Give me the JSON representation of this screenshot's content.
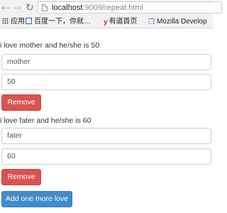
{
  "browser": {
    "url_host": "localhost",
    "url_rest": ":9009/repeat.html",
    "bookmarks": [
      {
        "icon": "apps-icon",
        "label": "应用"
      },
      {
        "icon": "image-icon",
        "label": "百度一下，你就…"
      },
      {
        "icon": "youdao-icon",
        "label": "有道首页"
      },
      {
        "icon": "mozilla-icon",
        "label": "Mozilla Develop"
      }
    ]
  },
  "people": [
    {
      "sentence": "i love mother and he/she is 50",
      "name": "mother",
      "age": "50",
      "remove_label": "Remove"
    },
    {
      "sentence": "i love fater and he/she is 60",
      "name": "fater",
      "age": "60",
      "remove_label": "Remove"
    }
  ],
  "add_label": "Add one more love",
  "colors": {
    "remove_button": "#d9534f",
    "add_button": "#428bca"
  }
}
